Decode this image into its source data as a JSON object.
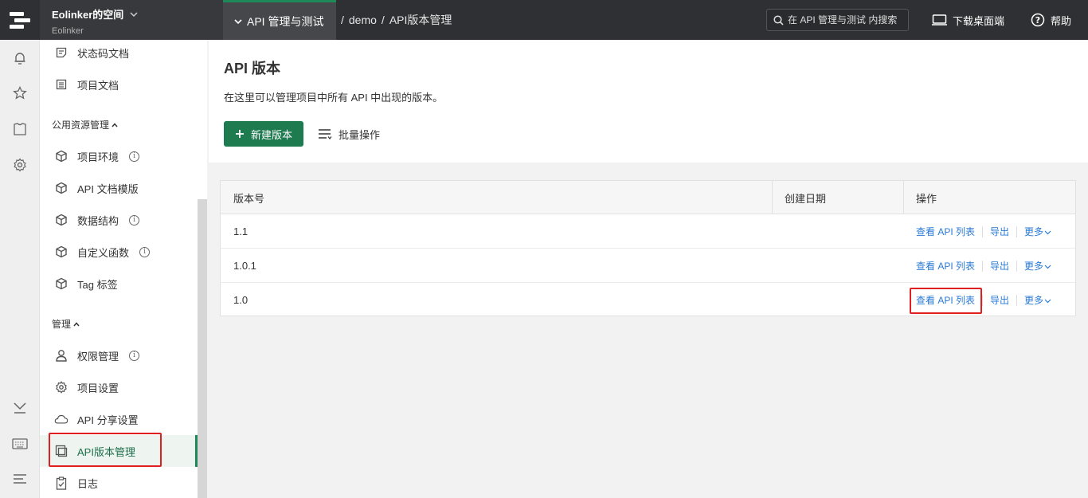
{
  "workspace": {
    "name": "Eolinker的空间",
    "sub": "Eolinker"
  },
  "project_menu": "API 管理与测试",
  "breadcrumb": [
    "demo",
    "API版本管理"
  ],
  "search": {
    "placeholder": "在 API 管理与测试 内搜索"
  },
  "top_actions": {
    "download": "下载桌面端",
    "help": "帮助"
  },
  "sidebar": {
    "items_top": [
      {
        "label": "状态码文档",
        "icon": "doc-icon"
      },
      {
        "label": "项目文档",
        "icon": "list-doc-icon"
      }
    ],
    "section_public": "公用资源管理",
    "items_public": [
      {
        "label": "项目环境",
        "icon": "cube-icon",
        "info": "i"
      },
      {
        "label": "API 文档模版",
        "icon": "cube-icon"
      },
      {
        "label": "数据结构",
        "icon": "cube-icon",
        "info": "i"
      },
      {
        "label": "自定义函数",
        "icon": "cube-icon",
        "info": "i"
      },
      {
        "label": "Tag 标签",
        "icon": "cube-icon"
      }
    ],
    "section_manage": "管理",
    "items_manage": [
      {
        "label": "权限管理",
        "icon": "user-icon",
        "info": "i"
      },
      {
        "label": "项目设置",
        "icon": "gear-icon"
      },
      {
        "label": "API 分享设置",
        "icon": "cloud-icon"
      },
      {
        "label": "API版本管理",
        "icon": "copy-icon",
        "active": true
      },
      {
        "label": "日志",
        "icon": "clipboard-icon"
      }
    ]
  },
  "main": {
    "title": "API 版本",
    "description": "在这里可以管理项目中所有 API 中出现的版本。",
    "new_button": "新建版本",
    "batch_button": "批量操作"
  },
  "table": {
    "headers": [
      "版本号",
      "创建日期",
      "操作"
    ],
    "rows": [
      {
        "version": "1.1",
        "date": ""
      },
      {
        "version": "1.0.1",
        "date": ""
      },
      {
        "version": "1.0",
        "date": ""
      }
    ],
    "actions": {
      "view": "查看 API 列表",
      "export": "导出",
      "more": "更多"
    }
  },
  "colors": {
    "accent": "#1e7a4f",
    "link": "#2a7ad4",
    "highlight": "#e02020",
    "topbar": "#2f3033"
  }
}
